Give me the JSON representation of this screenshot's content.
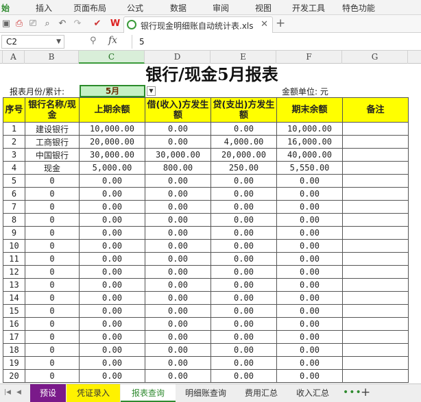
{
  "menu": {
    "items": [
      "始",
      "插入",
      "页面布局",
      "公式",
      "数据",
      "审阅",
      "视图",
      "开发工具",
      "特色功能"
    ]
  },
  "toolbar": {
    "doc_title": "银行现金明细账自动统计表.xls"
  },
  "formula_bar": {
    "cell_ref": "C2",
    "fx": "fx",
    "value": "5"
  },
  "columns": [
    "A",
    "B",
    "C",
    "D",
    "E",
    "F",
    "G"
  ],
  "sheet": {
    "title": "银行/现金5月报表",
    "month_label": "报表月份/累计:",
    "month_value": "5月",
    "unit_label": "金额单位: 元",
    "headers": [
      "序号",
      "银行名称/现金",
      "上期余额",
      "借(收入)方发生额",
      "贷(支出)方发生额",
      "期末余额",
      "备注"
    ],
    "rows": [
      [
        "1",
        "建设银行",
        "10,000.00",
        "0.00",
        "0.00",
        "10,000.00",
        ""
      ],
      [
        "2",
        "工商银行",
        "20,000.00",
        "0.00",
        "4,000.00",
        "16,000.00",
        ""
      ],
      [
        "3",
        "中国银行",
        "30,000.00",
        "30,000.00",
        "20,000.00",
        "40,000.00",
        ""
      ],
      [
        "4",
        "现金",
        "5,000.00",
        "800.00",
        "250.00",
        "5,550.00",
        ""
      ],
      [
        "5",
        "0",
        "0.00",
        "0.00",
        "0.00",
        "0.00",
        ""
      ],
      [
        "6",
        "0",
        "0.00",
        "0.00",
        "0.00",
        "0.00",
        ""
      ],
      [
        "7",
        "0",
        "0.00",
        "0.00",
        "0.00",
        "0.00",
        ""
      ],
      [
        "8",
        "0",
        "0.00",
        "0.00",
        "0.00",
        "0.00",
        ""
      ],
      [
        "9",
        "0",
        "0.00",
        "0.00",
        "0.00",
        "0.00",
        ""
      ],
      [
        "10",
        "0",
        "0.00",
        "0.00",
        "0.00",
        "0.00",
        ""
      ],
      [
        "11",
        "0",
        "0.00",
        "0.00",
        "0.00",
        "0.00",
        ""
      ],
      [
        "12",
        "0",
        "0.00",
        "0.00",
        "0.00",
        "0.00",
        ""
      ],
      [
        "13",
        "0",
        "0.00",
        "0.00",
        "0.00",
        "0.00",
        ""
      ],
      [
        "14",
        "0",
        "0.00",
        "0.00",
        "0.00",
        "0.00",
        ""
      ],
      [
        "15",
        "0",
        "0.00",
        "0.00",
        "0.00",
        "0.00",
        ""
      ],
      [
        "16",
        "0",
        "0.00",
        "0.00",
        "0.00",
        "0.00",
        ""
      ],
      [
        "17",
        "0",
        "0.00",
        "0.00",
        "0.00",
        "0.00",
        ""
      ],
      [
        "18",
        "0",
        "0.00",
        "0.00",
        "0.00",
        "0.00",
        ""
      ],
      [
        "19",
        "0",
        "0.00",
        "0.00",
        "0.00",
        "0.00",
        ""
      ],
      [
        "20",
        "0",
        "0.00",
        "0.00",
        "0.00",
        "0.00",
        ""
      ]
    ]
  },
  "sheet_tabs": [
    {
      "label": "预设",
      "style": "purple"
    },
    {
      "label": "凭证录入",
      "style": "yellow"
    },
    {
      "label": "报表查询",
      "style": "active"
    },
    {
      "label": "明细账查询",
      "style": "plain"
    },
    {
      "label": "费用汇总",
      "style": "plain"
    },
    {
      "label": "收入汇总",
      "style": "plain"
    }
  ],
  "colors": {
    "accent": "#2f8a2f",
    "header_fill": "#ffff00",
    "selected_cell": "#c4f0c4",
    "purple_tab": "#7a1a8a"
  }
}
